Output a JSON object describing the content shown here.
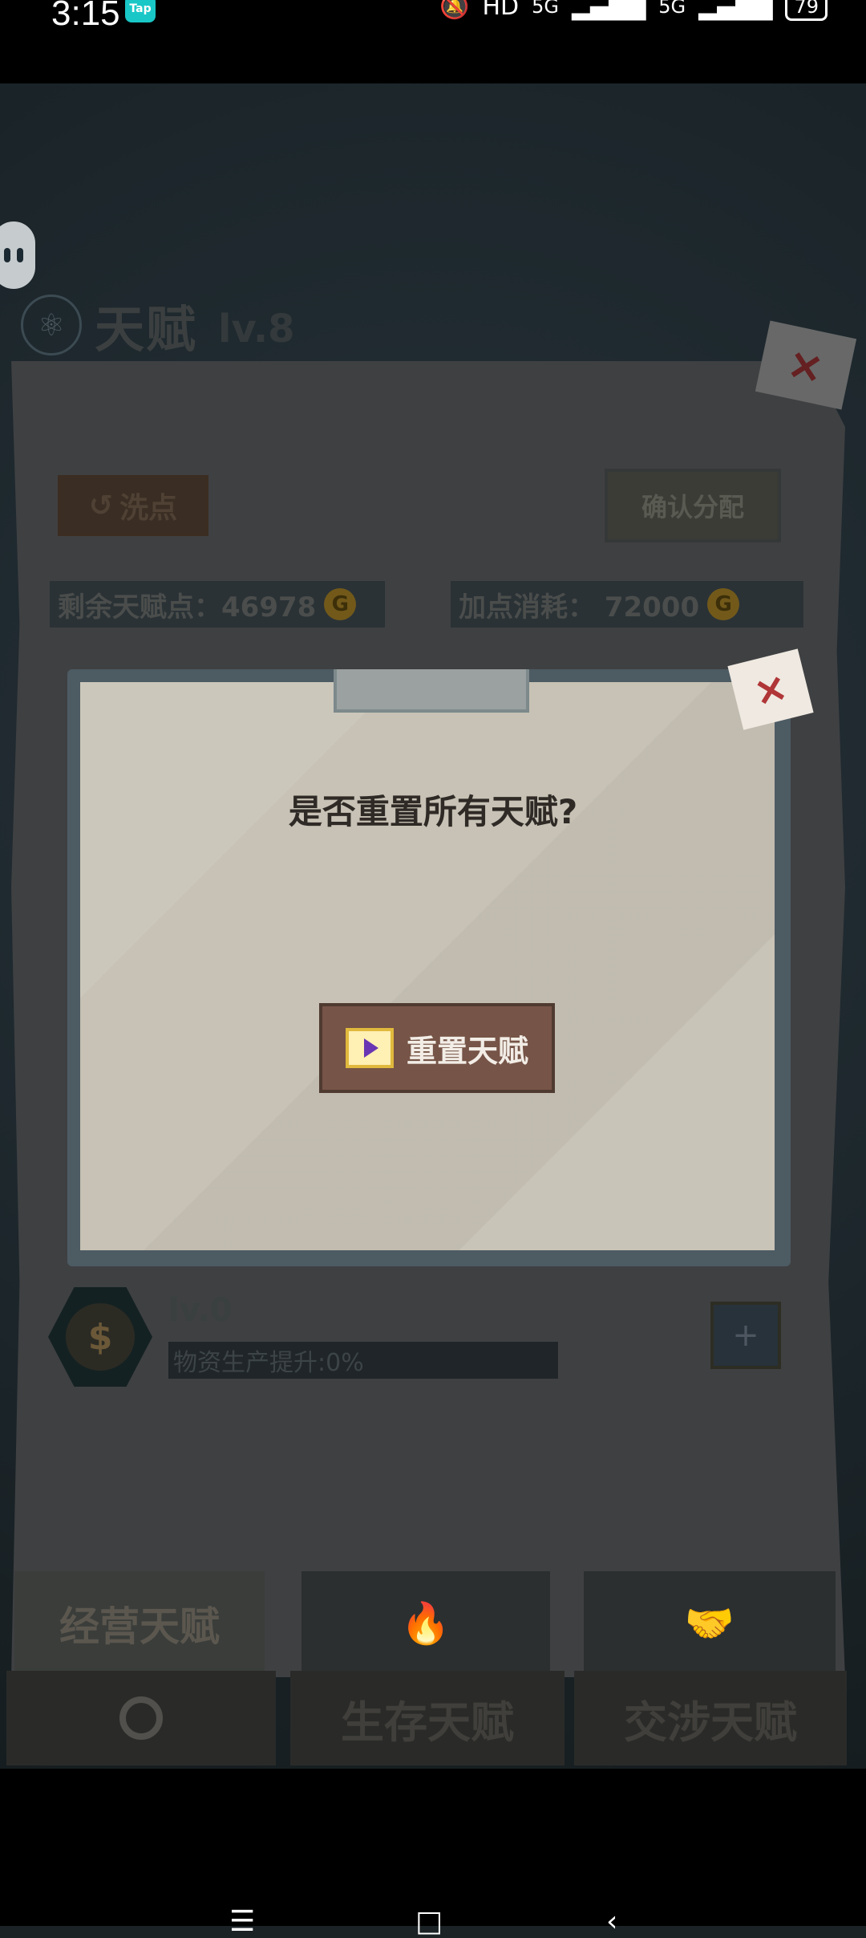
{
  "status_bar": {
    "time": "3:15",
    "tap_label": "Tap",
    "hd_label": "HD",
    "sim_1": "5G",
    "sim_2": "5G",
    "battery": "79"
  },
  "header": {
    "title": "天赋",
    "level": "lv.8"
  },
  "actions": {
    "wash_label": "洗点",
    "confirm_label": "确认分配"
  },
  "stats": {
    "remaining_label": "剩余天赋点：46978",
    "cost_label": "加点消耗：  72000"
  },
  "dialog": {
    "message": "是否重置所有天赋?",
    "button_label": "重置天赋"
  },
  "skill": {
    "level": "lv.0",
    "effect": "物资生产提升:0%"
  },
  "tabs": {
    "upper_active": "经营天赋",
    "lower_2": "生存天赋",
    "lower_3": "交涉天赋"
  }
}
